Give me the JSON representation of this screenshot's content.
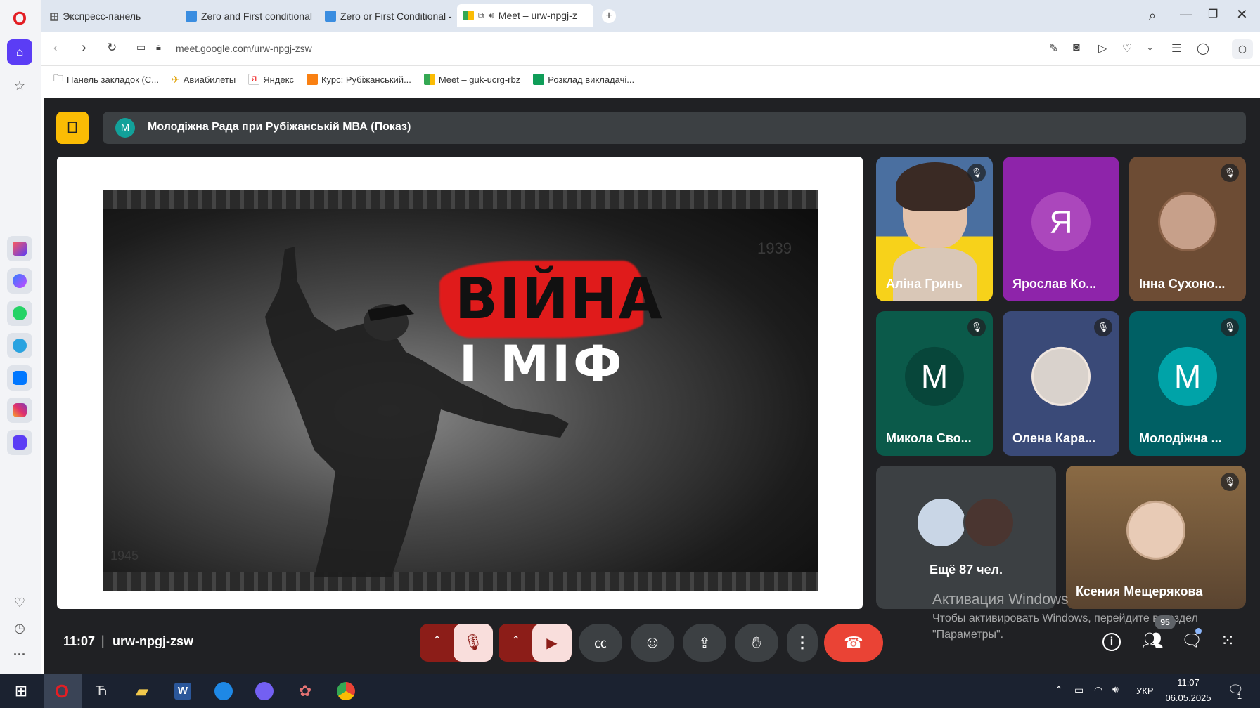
{
  "browser": {
    "tabs": [
      {
        "label": "Экспресс-панель"
      },
      {
        "label": "Zero and First conditional"
      },
      {
        "label": "Zero or First Conditional -"
      },
      {
        "label": "Meet – urw-npgj-z"
      }
    ],
    "url": "meet.google.com/urw-npgj-zsw",
    "bookmarks": [
      {
        "label": "Панель закладок (С..."
      },
      {
        "label": "Авиабилеты"
      },
      {
        "label": "Яндекс"
      },
      {
        "label": "Курс: Рубіжанський..."
      },
      {
        "label": "Meet – guk-ucrg-rbz"
      },
      {
        "label": "Розклад викладачі..."
      }
    ]
  },
  "meet": {
    "presenter_initial": "M",
    "presenter_title": "Молодіжна Рада при Рубіжанській МВА (Показ)",
    "slide": {
      "line1": "ВІЙНА",
      "line2": "І МІФ",
      "watermark_year": "1939",
      "watermark_year2": "1945"
    },
    "participants": [
      {
        "name": "Аліна Гринь",
        "type": "photo"
      },
      {
        "name": "Ярослав Ко...",
        "initial": "Я",
        "type": "initial"
      },
      {
        "name": "Інна Сухоно...",
        "type": "photo"
      },
      {
        "name": "Микола Сво...",
        "initial": "M",
        "type": "initial"
      },
      {
        "name": "Олена Кара...",
        "type": "photo"
      },
      {
        "name": "Молодіжна ...",
        "initial": "M",
        "type": "initial"
      }
    ],
    "more_label": "Ещё 87 чел.",
    "featured_name": "Ксения Мещерякова",
    "time": "11:07",
    "separator": "|",
    "meeting_code": "urw-npgj-zsw",
    "participants_count": "95",
    "activation_title": "Активация Windows",
    "activation_text1": "Чтобы активировать Windows, перейдите в раздел",
    "activation_text2": "\"Параметры\"."
  },
  "taskbar": {
    "lang": "УКР",
    "time": "11:07",
    "date": "06.05.2025",
    "notif_count": "1"
  },
  "colors": {
    "meet_bg": "#202124",
    "end_call": "#ea4335",
    "muted_red": "#f9dedc",
    "brand_red": "#e53935"
  }
}
